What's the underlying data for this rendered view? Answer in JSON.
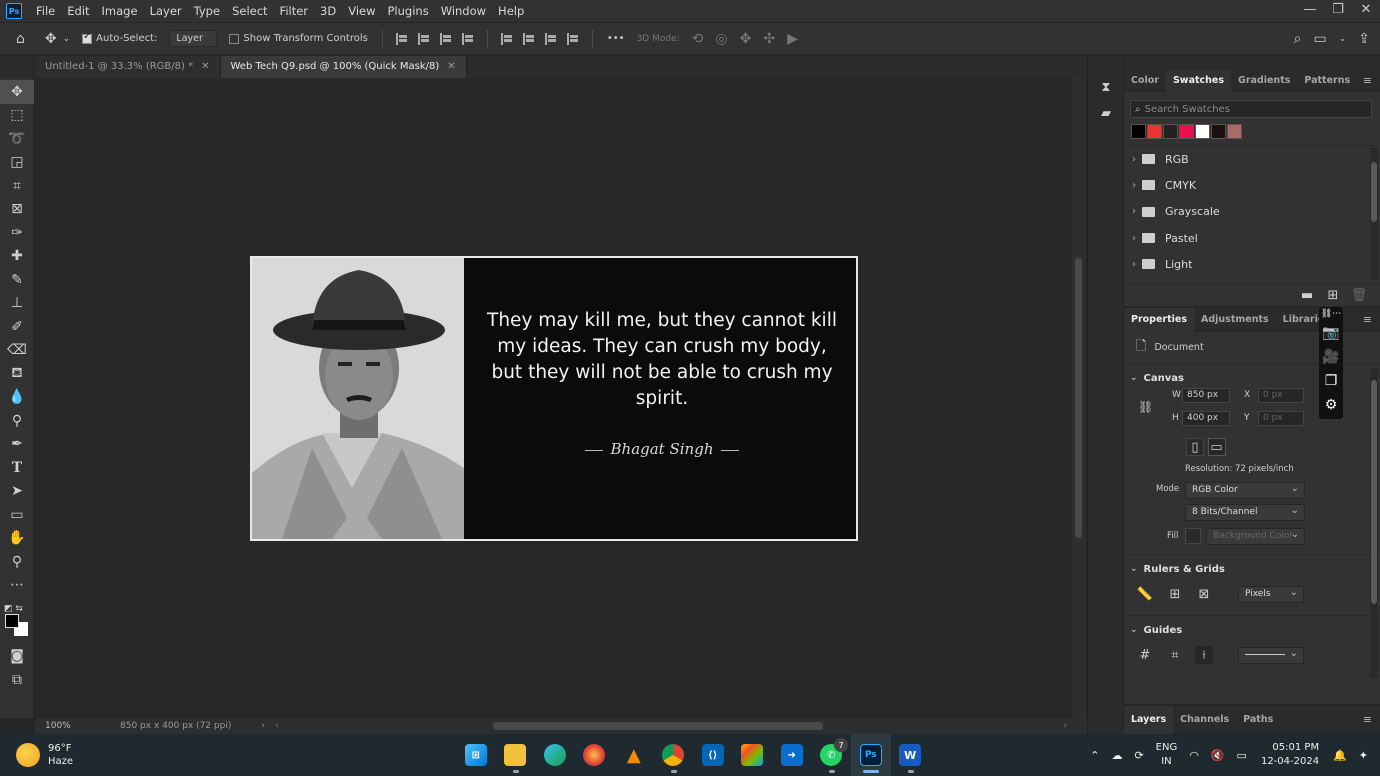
{
  "app": {
    "logo": "Ps",
    "menu": [
      "File",
      "Edit",
      "Image",
      "Layer",
      "Type",
      "Select",
      "Filter",
      "3D",
      "View",
      "Plugins",
      "Window",
      "Help"
    ]
  },
  "options": {
    "auto_select_label": "Auto-Select:",
    "auto_select_checked": true,
    "layer_select_value": "Layer",
    "show_transform_label": "Show Transform Controls",
    "more_label": "•••",
    "mode_3d_label": "3D Mode:"
  },
  "tabs": [
    {
      "label": "Untitled-1 @ 33.3% (RGB/8) *",
      "active": false
    },
    {
      "label": "Web Tech Q9.psd @ 100% (Quick Mask/8)",
      "active": true
    }
  ],
  "document": {
    "quote": "They may kill me, but they cannot kill my ideas. They can crush my body, but they will not be able to crush my spirit.",
    "author": "Bhagat Singh"
  },
  "status": {
    "zoom": "100%",
    "doc_size": "850 px x 400 px (72 ppi)"
  },
  "swatches_panel": {
    "tabs": [
      "Color",
      "Swatches",
      "Gradients",
      "Patterns"
    ],
    "active_tab": "Swatches",
    "search_placeholder": "Search Swatches",
    "recent_colors": [
      "#000000",
      "#ee3333",
      "#222222",
      "#e8114d",
      "#ffffff",
      "#1e0f0f",
      "#a86a6a"
    ],
    "folders": [
      "RGB",
      "CMYK",
      "Grayscale",
      "Pastel",
      "Light"
    ]
  },
  "properties_panel": {
    "tabs": [
      "Properties",
      "Adjustments",
      "Libraries"
    ],
    "active_tab": "Properties",
    "doc_label": "Document",
    "canvas_title": "Canvas",
    "w_label": "W",
    "w_value": "850 px",
    "h_label": "H",
    "h_value": "400 px",
    "x_label": "X",
    "x_placeholder": "0 px",
    "y_label": "Y",
    "y_placeholder": "0 px",
    "resolution": "Resolution: 72 pixels/inch",
    "mode_label": "Mode",
    "mode_value": "RGB Color",
    "bits_value": "8 Bits/Channel",
    "fill_label": "Fill",
    "fill_value": "Background Color",
    "rulers_title": "Rulers & Grids",
    "units_value": "Pixels",
    "guides_title": "Guides"
  },
  "layers_panel": {
    "tabs": [
      "Layers",
      "Channels",
      "Paths"
    ],
    "active_tab": "Layers"
  },
  "taskbar": {
    "temp": "96°F",
    "condition": "Haze",
    "whatsapp_badge": "7",
    "lang_line1": "ENG",
    "lang_line2": "IN",
    "time": "05:01 PM",
    "date": "12-04-2024"
  }
}
